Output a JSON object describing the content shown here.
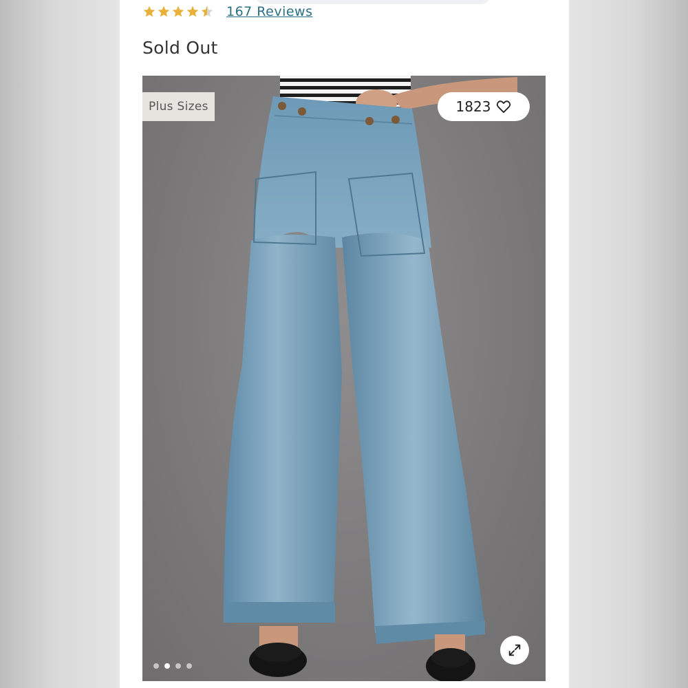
{
  "product": {
    "rating": 4.5,
    "reviews_label": "167 Reviews",
    "status": "Sold Out"
  },
  "image": {
    "badge": "Plus Sizes",
    "like_count": "1823",
    "slide_count": 4,
    "active_slide": 2
  },
  "colors": {
    "star": "#e8b23a",
    "link": "#2b6f86",
    "denim": "#6f9ab7"
  },
  "icons": {
    "star": "star-icon",
    "heart": "heart-icon",
    "expand": "expand-icon"
  }
}
